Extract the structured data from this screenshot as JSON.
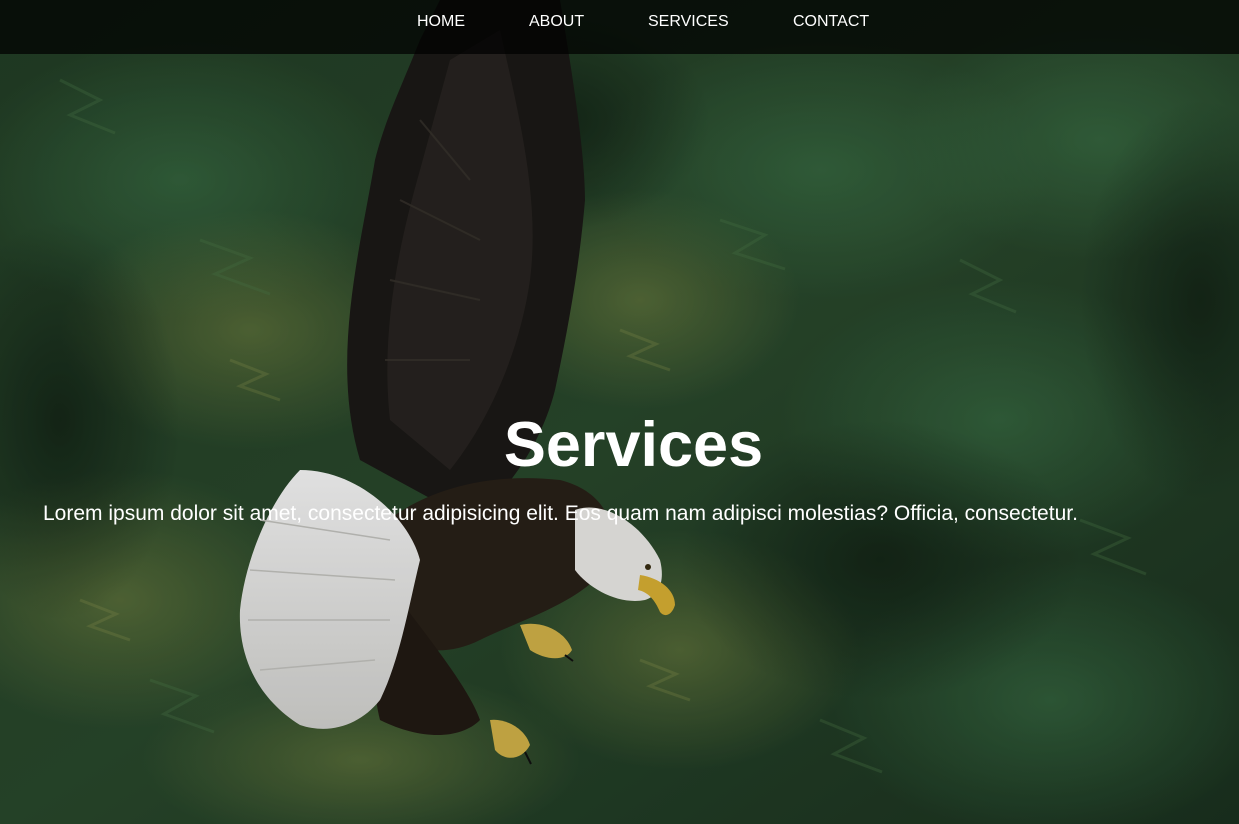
{
  "nav": {
    "items": [
      {
        "label": "HOME"
      },
      {
        "label": "ABOUT"
      },
      {
        "label": "SERVICES"
      },
      {
        "label": "CONTACT"
      }
    ]
  },
  "hero": {
    "title": "Services",
    "subtitle": "Lorem ipsum dolor sit amet, consectetur adipisicing elit. Eos quam nam adipisci molestias? Officia, consectetur.",
    "background": "eagle-over-forest-photo"
  },
  "colors": {
    "nav_bg": "#000000",
    "text": "#ffffff",
    "forest_dark": "#1a2e1c",
    "forest_mid": "#2f5a34",
    "forest_light": "#6b7f3c"
  }
}
